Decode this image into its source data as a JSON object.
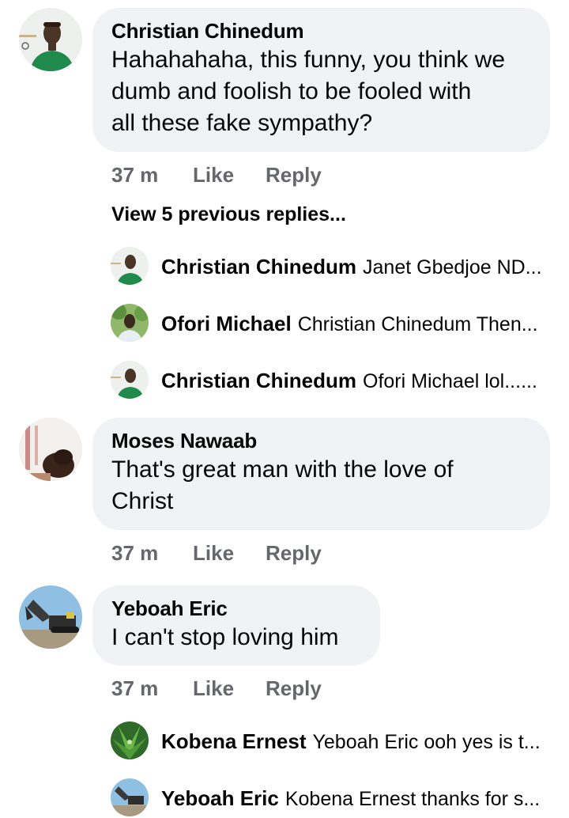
{
  "comments": [
    {
      "author": "Christian Chinedum",
      "text_lines": [
        "Hahahahaha, this funny, you think we",
        "dumb and foolish to be fooled with",
        "all these fake sympathy?"
      ],
      "time": "37 m",
      "like": "Like",
      "reply": "Reply",
      "view_previous": "View 5 previous replies...",
      "replies": [
        {
          "author": "Christian Chinedum",
          "text": "Janet Gbedjoe ND..."
        },
        {
          "author": "Ofori Michael",
          "text": "Christian Chinedum Then..."
        },
        {
          "author": "Christian Chinedum",
          "text": "Ofori Michael lol......"
        }
      ]
    },
    {
      "author": "Moses Nawaab",
      "text_lines": [
        "That's great man with the love of",
        "Christ"
      ],
      "time": "37 m",
      "like": "Like",
      "reply": "Reply"
    },
    {
      "author": "Yeboah Eric",
      "text_lines": [
        "I can't stop loving him"
      ],
      "time": "37 m",
      "like": "Like",
      "reply": "Reply",
      "replies": [
        {
          "author": "Kobena Ernest",
          "text": "Yeboah Eric ooh yes is t..."
        },
        {
          "author": "Yeboah Eric",
          "text": "Kobena Ernest thanks for s..."
        }
      ]
    }
  ],
  "colors": {
    "bubble": "#f0f2f5",
    "meta_text": "#65676b",
    "primary_text": "#050505"
  }
}
